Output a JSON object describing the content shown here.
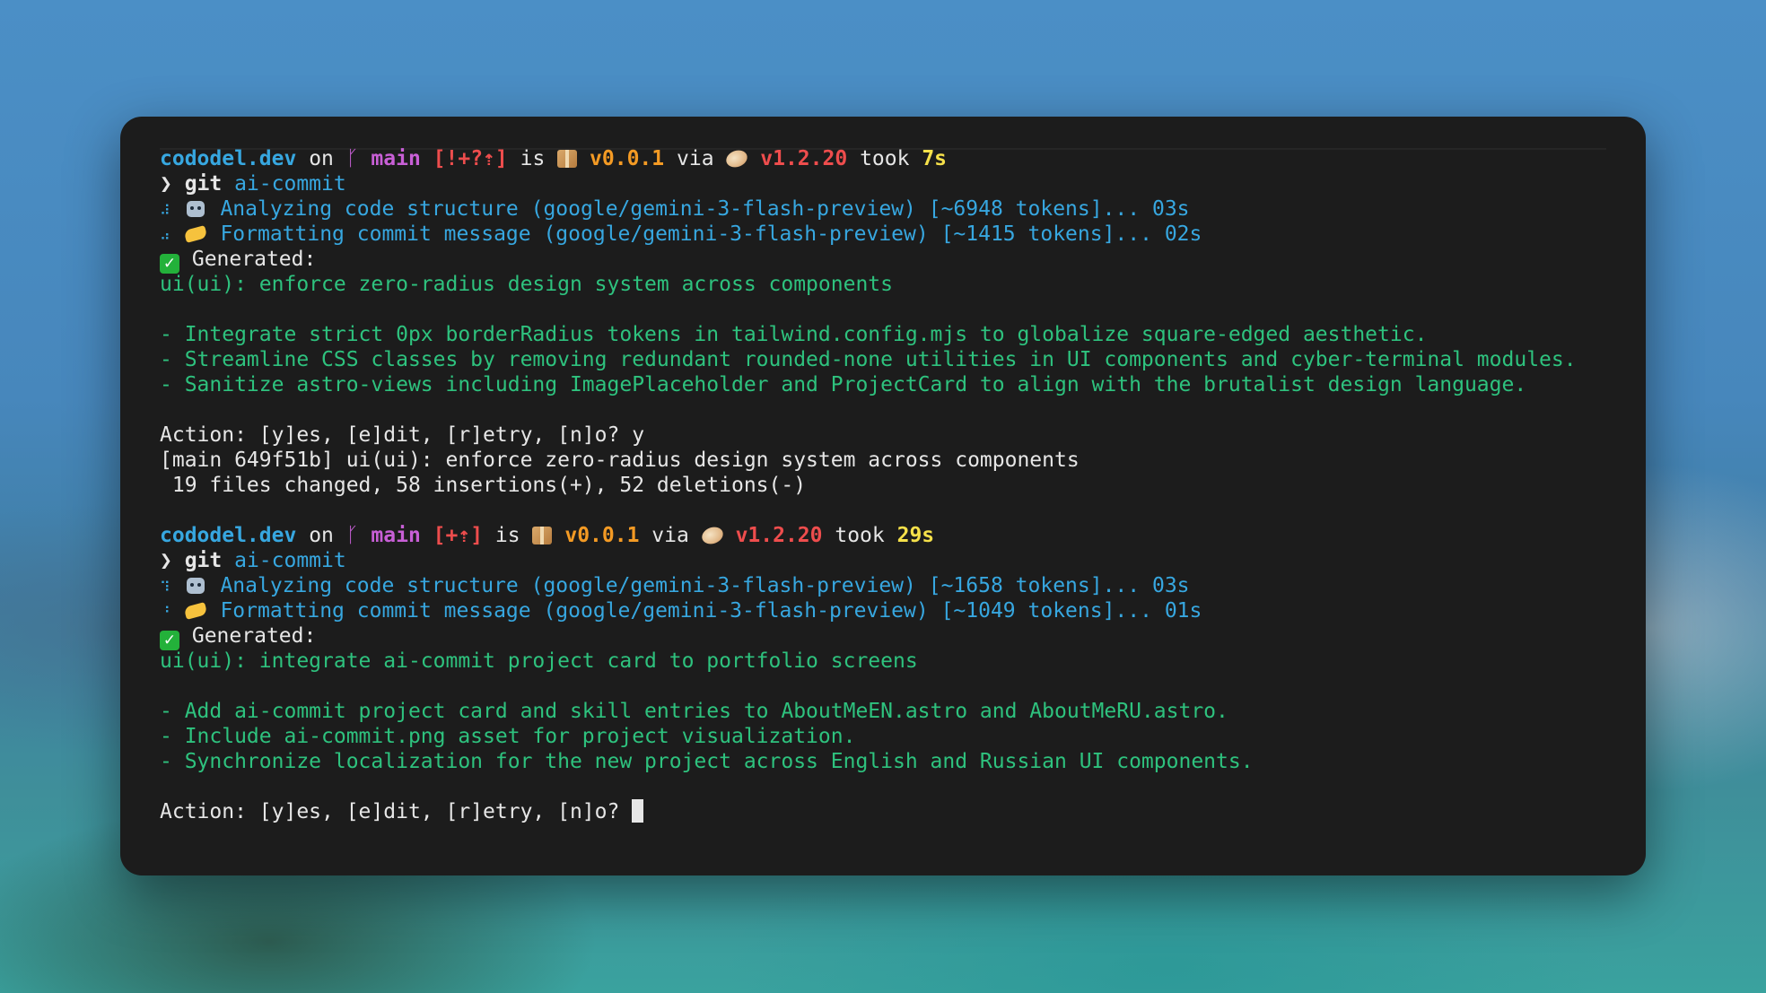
{
  "terminal": {
    "blocks": [
      {
        "prompt": {
          "host": "cododel.dev",
          "on": "on",
          "branch_icon": "git-branch-icon",
          "branch": "main",
          "git_status": "[!+?⇡]",
          "is": "is",
          "package_icon": "package-icon",
          "package_version": "v0.0.1",
          "via": "via",
          "runtime_icon": "bun-icon",
          "runtime_version": "v1.2.20",
          "took": "took",
          "duration": "7s"
        },
        "command_prefix": "❯ git ",
        "command_arg": "ai-commit",
        "progress": [
          {
            "spinner": "⠼",
            "icon": "robot-icon",
            "text": "Analyzing code structure (google/gemini-3-flash-preview) [~6948 tokens]... 03s"
          },
          {
            "spinner": "⠴",
            "icon": "writing-hand-icon",
            "text": "Formatting commit message (google/gemini-3-flash-preview) [~1415 tokens]... 02s"
          }
        ],
        "generated_label": "Generated:",
        "commit_title": "ui(ui): enforce zero-radius design system across components",
        "commit_body": [
          "- Integrate strict 0px borderRadius tokens in tailwind.config.mjs to globalize square-edged aesthetic.",
          "- Streamline CSS classes by removing redundant rounded-none utilities in UI components and cyber-terminal modules.",
          "- Sanitize astro-views including ImagePlaceholder and ProjectCard to align with the brutalist design language."
        ],
        "action_prompt": "Action: [y]es, [e]dit, [r]etry, [n]o? y",
        "result_lines": [
          "[main 649f51b] ui(ui): enforce zero-radius design system across components",
          " 19 files changed, 58 insertions(+), 52 deletions(-)"
        ]
      },
      {
        "prompt": {
          "host": "cododel.dev",
          "on": "on",
          "branch_icon": "git-branch-icon",
          "branch": "main",
          "git_status": "[+⇡]",
          "is": "is",
          "package_icon": "package-icon",
          "package_version": "v0.0.1",
          "via": "via",
          "runtime_icon": "bun-icon",
          "runtime_version": "v1.2.20",
          "took": "took",
          "duration": "29s"
        },
        "command_prefix": "❯ git ",
        "command_arg": "ai-commit",
        "progress": [
          {
            "spinner": "⠹",
            "icon": "robot-icon",
            "text": "Analyzing code structure (google/gemini-3-flash-preview) [~1658 tokens]... 03s"
          },
          {
            "spinner": "⠘",
            "icon": "writing-hand-icon",
            "text": "Formatting commit message (google/gemini-3-flash-preview) [~1049 tokens]... 01s"
          }
        ],
        "generated_label": "Generated:",
        "commit_title": "ui(ui): integrate ai-commit project card to portfolio screens",
        "commit_body": [
          "- Add ai-commit project card and skill entries to AboutMeEN.astro and AboutMeRU.astro.",
          "- Include ai-commit.png asset for project visualization.",
          "- Synchronize localization for the new project across English and Russian UI components."
        ],
        "action_prompt": "Action: [y]es, [e]dit, [r]etry, [n]o? "
      }
    ],
    "colors": {
      "background": "#1c1c1c",
      "host": "#37a7e0",
      "branch": "#c85fd6",
      "git_status": "#ee4d4d",
      "package_version": "#f39a24",
      "runtime_version": "#ee4d4d",
      "duration": "#f5e04a",
      "generated_output": "#2ec27e",
      "progress": "#37a7e0"
    }
  }
}
